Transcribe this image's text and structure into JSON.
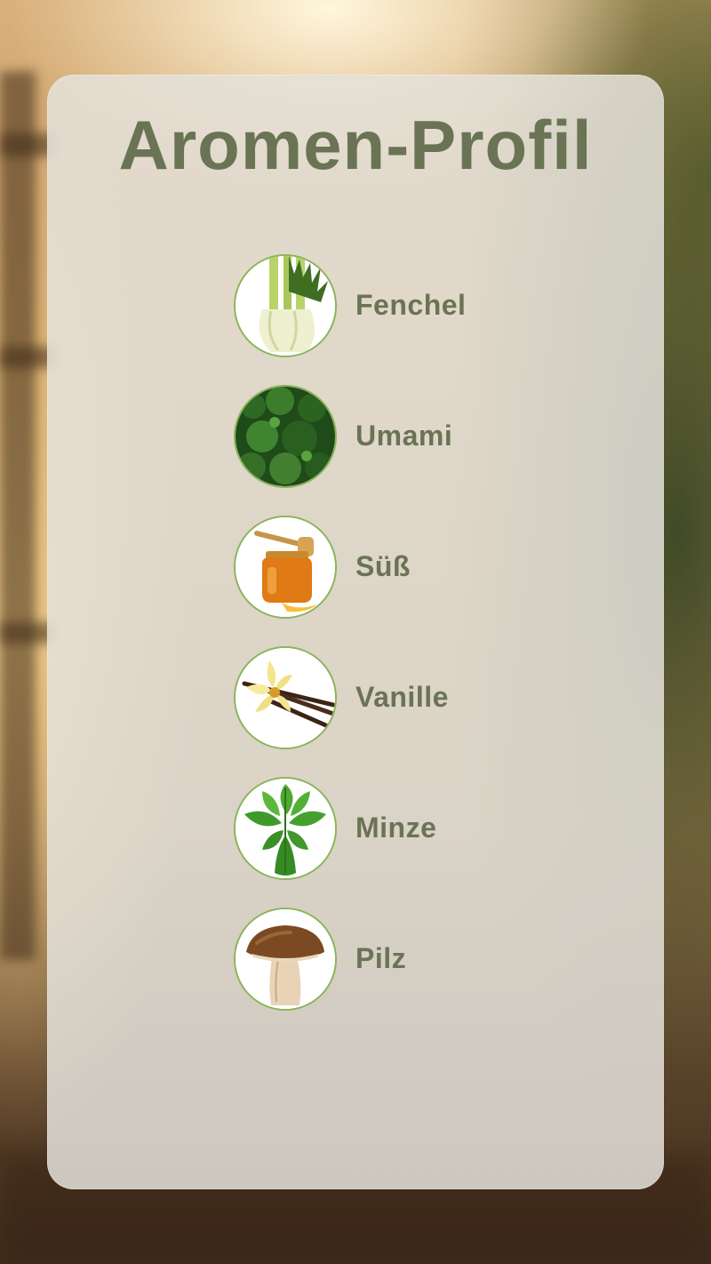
{
  "title": "Aromen-Profil",
  "colors": {
    "title_text": "#6a7455",
    "circle_border": "#8bb458",
    "panel": "#e4e2db"
  },
  "items": [
    {
      "label": "Fenchel",
      "icon": "fennel-icon"
    },
    {
      "label": "Umami",
      "icon": "green-leaves-icon"
    },
    {
      "label": "Süß",
      "icon": "honey-jar-icon"
    },
    {
      "label": "Vanille",
      "icon": "vanilla-icon"
    },
    {
      "label": "Minze",
      "icon": "mint-icon"
    },
    {
      "label": "Pilz",
      "icon": "mushroom-icon"
    }
  ]
}
